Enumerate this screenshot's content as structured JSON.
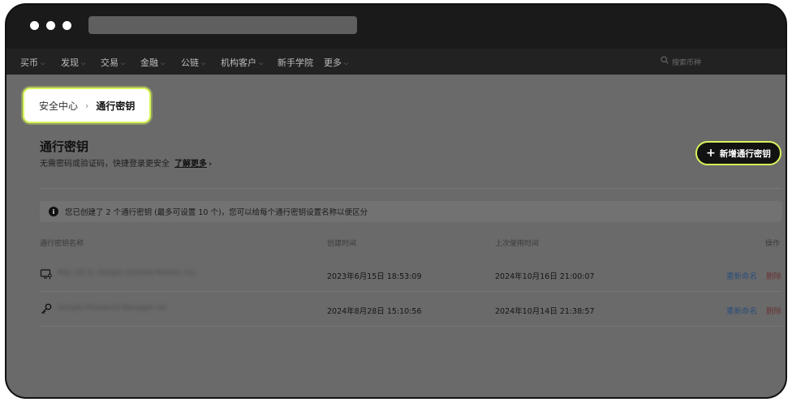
{
  "nav": {
    "items": [
      {
        "label": "买币",
        "has_dropdown": true
      },
      {
        "label": "发现",
        "has_dropdown": true
      },
      {
        "label": "交易",
        "has_dropdown": true
      },
      {
        "label": "金融",
        "has_dropdown": true
      },
      {
        "label": "公链",
        "has_dropdown": true
      },
      {
        "label": "机构客户",
        "has_dropdown": true
      },
      {
        "label": "新手学院",
        "has_dropdown": false
      },
      {
        "label": "更多",
        "has_dropdown": true
      }
    ],
    "search_placeholder": "搜索币种"
  },
  "breadcrumb": {
    "parent": "安全中心",
    "current": "通行密钥"
  },
  "page": {
    "title": "通行密钥",
    "subtitle": "无需密码或验证码，快捷登录更安全",
    "learn_more": "了解更多",
    "learn_more_chevron": "›",
    "new_button": "新增通行密钥",
    "new_button_icon": "+"
  },
  "info": {
    "icon": "i",
    "text": "您已创建了 2 个通行密钥 (最多可设置 10 个)，您可以给每个通行密钥设置名称以便区分"
  },
  "table": {
    "headers": {
      "name": "通行密钥名称",
      "created": "创建时间",
      "last_used": "上次使用时间",
      "actions": "操作"
    },
    "rows": [
      {
        "icon": "device-key-icon",
        "name": "Mac OS X, Google Chrome Mobile, Inc",
        "created": "2023年6月15日 18:53:09",
        "last_used": "2024年10月16日 21:00:07",
        "rename": "重新命名",
        "delete": "删除"
      },
      {
        "icon": "key-icon",
        "name": "Google Password Manager Inc",
        "created": "2024年8月28日 15:10:56",
        "last_used": "2024年10月14日 21:38:57",
        "rename": "重新命名",
        "delete": "删除"
      }
    ]
  },
  "colors": {
    "accent_highlight": "#d7f55a",
    "frame": "#1a1a1a",
    "overlay_content": "#6a6a6a",
    "rename_link": "#2a4d7a",
    "delete_link": "#6b3434"
  }
}
